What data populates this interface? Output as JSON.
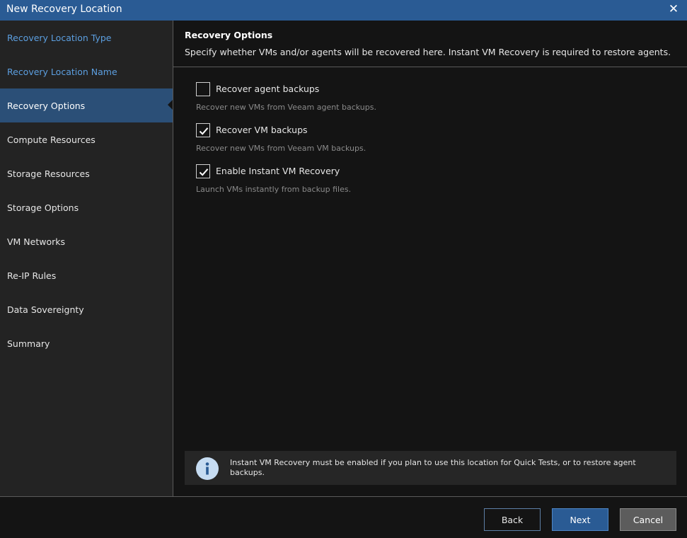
{
  "window": {
    "title": "New Recovery Location"
  },
  "sidebar": {
    "items": [
      {
        "label": "Recovery Location Type",
        "state": "done"
      },
      {
        "label": "Recovery Location Name",
        "state": "done"
      },
      {
        "label": "Recovery Options",
        "state": "active"
      },
      {
        "label": "Compute Resources",
        "state": "pending"
      },
      {
        "label": "Storage Resources",
        "state": "pending"
      },
      {
        "label": "Storage Options",
        "state": "pending"
      },
      {
        "label": "VM Networks",
        "state": "pending"
      },
      {
        "label": "Re-IP Rules",
        "state": "pending"
      },
      {
        "label": "Data Sovereignty",
        "state": "pending"
      },
      {
        "label": "Summary",
        "state": "pending"
      }
    ]
  },
  "header": {
    "title": "Recovery Options",
    "description": "Specify whether VMs and/or agents will be recovered here. Instant VM Recovery is required to restore agents."
  },
  "options": [
    {
      "label": "Recover agent backups",
      "description": "Recover new VMs from Veeam agent backups.",
      "checked": false
    },
    {
      "label": "Recover VM backups",
      "description": "Recover new VMs from Veeam VM backups.",
      "checked": true
    },
    {
      "label": "Enable Instant VM Recovery",
      "description": "Launch VMs instantly from backup files.",
      "checked": true
    }
  ],
  "info": {
    "icon": "info-icon",
    "text": "Instant VM Recovery must be enabled if you plan to use this location for Quick Tests, or to restore agent backups."
  },
  "buttons": {
    "back": "Back",
    "next": "Next",
    "cancel": "Cancel"
  },
  "colors": {
    "titlebar": "#2a5b94",
    "sidebar": "#232323",
    "active_item": "#2b4f77",
    "done_item_text": "#5c9fe0",
    "background": "#141414",
    "primary_button": "#2a5b94"
  }
}
